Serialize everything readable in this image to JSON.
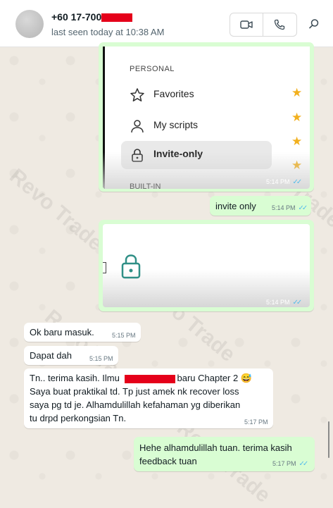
{
  "header": {
    "contact_name": "+60 17-700",
    "last_seen": "last seen today at 10:38 AM",
    "icons": [
      "video-call-icon",
      "voice-call-icon",
      "search-icon"
    ]
  },
  "watermark": "Revo Trade Cara Revo Trade",
  "image1": {
    "section_label": "PERSONAL",
    "items": [
      {
        "label": "Favorites",
        "icon": "star-outline-icon"
      },
      {
        "label": "My scripts",
        "icon": "person-icon"
      },
      {
        "label": "Invite-only",
        "icon": "lock-icon"
      }
    ],
    "next_section_label": "BUILT-IN",
    "time": "5:14 PM"
  },
  "messages": [
    {
      "id": "m1",
      "dir": "out",
      "text": "invite only",
      "time": "5:14 PM"
    },
    {
      "id": "m2",
      "dir": "out",
      "type": "image",
      "icon": "lock-icon",
      "time": "5:14 PM"
    },
    {
      "id": "m3",
      "dir": "in",
      "text": "Ok baru masuk.",
      "time": "5:15 PM"
    },
    {
      "id": "m4",
      "dir": "in",
      "text": "Dapat dah",
      "time": "5:15 PM"
    },
    {
      "id": "m5",
      "dir": "in",
      "line1_a": "Tn.. terima kasih.  Ilmu",
      "line1_b": "baru Chapter 2 😅",
      "line2": "Saya buat praktikal td. Tp just amek nk recover loss",
      "line3": "saya pg td je.  Alhamdulillah kefahaman yg diberikan",
      "line4": "tu drpd perkongsian Tn.",
      "time": "5:17 PM"
    },
    {
      "id": "m6",
      "dir": "out",
      "line1": "Hehe alhamdulillah tuan. terima kasih",
      "line2": "feedback tuan",
      "time": "5:17 PM"
    }
  ],
  "colors": {
    "outgoing": "#d9fdd3",
    "incoming": "#ffffff",
    "read_ticks": "#53bdeb",
    "redaction": "#e5001a",
    "chat_bg": "#efeae2"
  }
}
